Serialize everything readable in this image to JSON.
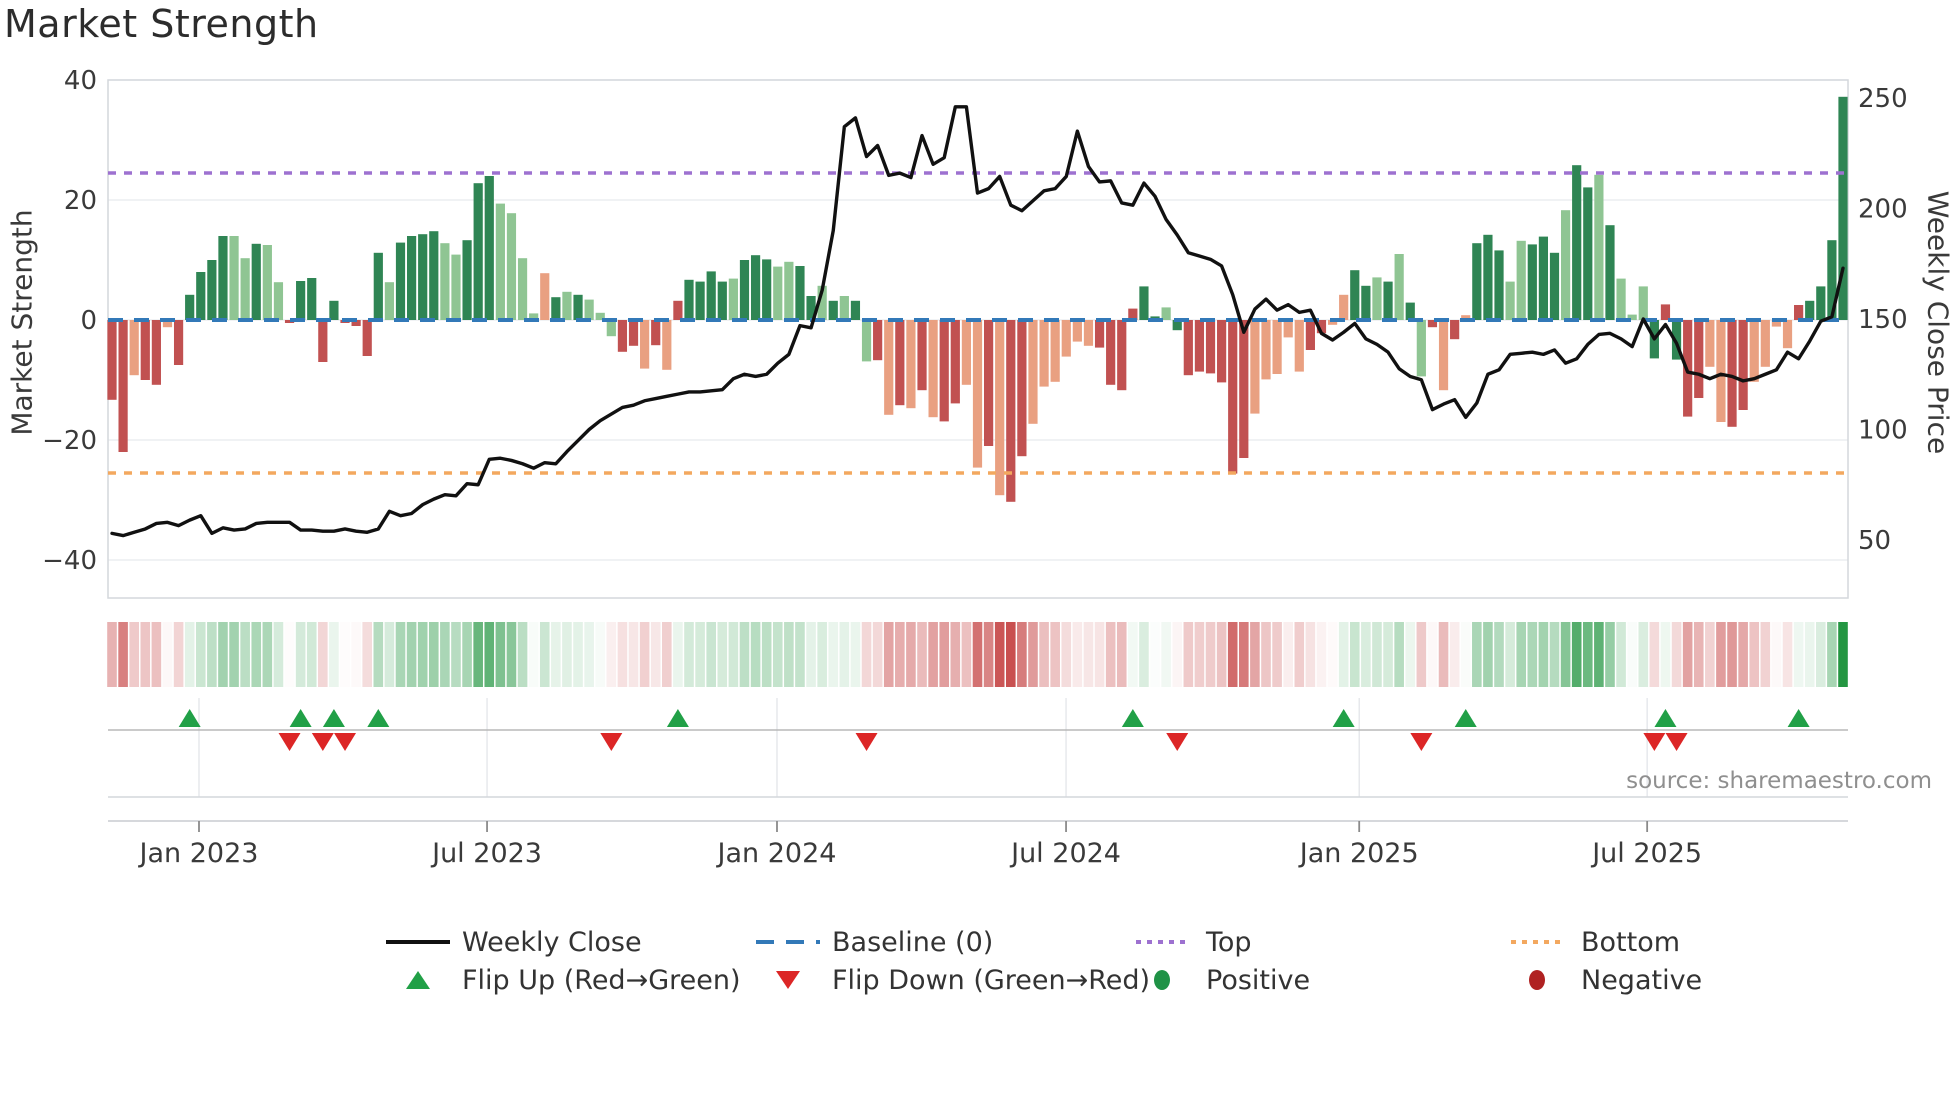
{
  "app": {
    "title": "Market Strength",
    "source_text": "source: sharemaestro.com"
  },
  "colors": {
    "bar_dark_green": "#2f8554",
    "bar_light_green": "#8fc593",
    "bar_red": "#c15151",
    "bar_salmon": "#e9a081",
    "baseline_blue": "#3279b8",
    "top_purple": "#9d71d0",
    "bottom_orange": "#f3a85f",
    "price_line": "#111111",
    "flip_up_green": "#21a047",
    "flip_down_red": "#dc2626",
    "positive_dot": "#1f9246",
    "negative_dot": "#b02222",
    "heat_green_base": [
      36,
      150,
      66
    ],
    "heat_red_base": [
      196,
      64,
      64
    ],
    "grid": "#e8eaee",
    "spine": "#d4d7dc",
    "tick_text": "#3a3a3a"
  },
  "legend": {
    "rows": [
      [
        {
          "label": "Weekly Close",
          "swatch": "line-black"
        },
        {
          "label": "Baseline (0)",
          "swatch": "dash-blue"
        },
        {
          "label": "Top",
          "swatch": "dot-purple"
        },
        {
          "label": "Bottom",
          "swatch": "dot-orange"
        }
      ],
      [
        {
          "label": "Flip Up (Red→Green)",
          "swatch": "tri-up"
        },
        {
          "label": "Flip Down (Green→Red)",
          "swatch": "tri-down"
        },
        {
          "label": "Positive",
          "swatch": "dot-green"
        },
        {
          "label": "Negative",
          "swatch": "dot-darkred"
        }
      ]
    ]
  },
  "chart_data": {
    "type": "bar",
    "subtype": "weekly strength bars + weekly close price line + heatmap strip + flip markers",
    "title": "Market Strength",
    "left_axis": {
      "label": "Market Strength",
      "ticks": [
        40,
        20,
        0,
        -20,
        -40
      ],
      "ylim": [
        -40,
        40
      ]
    },
    "right_axis": {
      "label": "Weekly Close Price",
      "ticks": [
        250,
        200,
        150,
        100,
        50
      ],
      "ylim": [
        40,
        260
      ]
    },
    "x_axis": {
      "ticks": [
        {
          "label": "Jan 2023",
          "week": 7.84
        },
        {
          "label": "Jul 2023",
          "week": 33.8
        },
        {
          "label": "Jan 2024",
          "week": 59.93
        },
        {
          "label": "Jul 2024",
          "week": 85.98
        },
        {
          "label": "Jan 2025",
          "week": 112.4
        },
        {
          "label": "Jul 2025",
          "week": 138.35
        }
      ]
    },
    "baseline": 0,
    "top_line": 24.5,
    "bottom_line": -25.5,
    "series": [
      {
        "name": "Strength",
        "type": "bar",
        "values": [
          -13.3,
          -22,
          -9.2,
          -10,
          -10.8,
          -1.2,
          -7.5,
          4.2,
          8,
          10,
          14,
          14,
          10.3,
          12.7,
          12.5,
          6.3,
          -0.5,
          6.5,
          7,
          -7,
          3.2,
          -0.5,
          -1,
          -6,
          11.2,
          6.3,
          12.9,
          14,
          14.3,
          14.8,
          12.8,
          10.9,
          13.3,
          22.8,
          24,
          19.4,
          17.8,
          10.3,
          1.1,
          7.8,
          3.8,
          4.7,
          4.2,
          3.4,
          1.2,
          -2.7,
          -5.3,
          -4.3,
          -8.1,
          -4.2,
          -8.3,
          3.2,
          6.7,
          6.4,
          8.1,
          6.4,
          6.9,
          10,
          10.8,
          10.1,
          8.9,
          9.7,
          9,
          4,
          5.7,
          3.2,
          4,
          3.2,
          -6.9,
          -6.7,
          -15.8,
          -14.2,
          -14.7,
          -11.7,
          -16.2,
          -16.9,
          -13.9,
          -10.8,
          -24.6,
          -21,
          -29.2,
          -30.3,
          -22.7,
          -17.3,
          -11.1,
          -10.3,
          -6.1,
          -3.6,
          -4.3,
          -4.6,
          -10.8,
          -11.7,
          1.9,
          5.6,
          0.6,
          2.1,
          -1.7,
          -9.2,
          -8.6,
          -8.9,
          -10.4,
          -25.6,
          -23,
          -15.6,
          -9.9,
          -9,
          -2.9,
          -8.6,
          -5,
          -2.2,
          -0.8,
          4.2,
          8.3,
          5.7,
          7.1,
          6.4,
          11,
          2.9,
          -9.4,
          -1.2,
          -11.7,
          -3.2,
          0.8,
          12.8,
          14.2,
          11.6,
          6.4,
          13.2,
          12.6,
          13.9,
          11.2,
          18.3,
          25.8,
          22.1,
          24.2,
          15.8,
          6.9,
          0.9,
          5.6,
          -6.4,
          2.6,
          -6.6,
          -16.1,
          -13,
          -7.8,
          -17,
          -17.8,
          -15,
          -10.3,
          -7.8,
          -1.1,
          -4.7,
          2.5,
          3.2,
          5.6,
          13.3,
          37.2
        ],
        "shades": "rrsrrsrddddlldllrddrdrrrdlddddlldddllllsdldlllrrsrsrddddldddllddldldlrsrsrsrrssrsrrssssssrrrrddldrrrrrrsssssrrssddldldlrsrsdddlldddlddldllldrdrrssrrssssrddddd"
      },
      {
        "name": "Weekly Close",
        "type": "line",
        "values": [
          53,
          52,
          53.5,
          55,
          57.5,
          58,
          56.5,
          59,
          61,
          53,
          55.5,
          54.5,
          55,
          57.5,
          58,
          58,
          58,
          54.5,
          54.5,
          54,
          54,
          55,
          54,
          53.5,
          55,
          63,
          61,
          62,
          66,
          68.5,
          70.5,
          70,
          75.5,
          75,
          86.5,
          87,
          86,
          84.5,
          82.5,
          85,
          84.5,
          90,
          95,
          100,
          104,
          107,
          110,
          111,
          113,
          114,
          115,
          116,
          117,
          117,
          117.5,
          118,
          123,
          125,
          124,
          125,
          130,
          134,
          147,
          146,
          163,
          190,
          237,
          241,
          223.5,
          228.5,
          215,
          216,
          214,
          233,
          220,
          223,
          246,
          246,
          207,
          209,
          214.5,
          201.5,
          199,
          203.5,
          208,
          209,
          214.5,
          235,
          219,
          212,
          212.5,
          202.5,
          201.5,
          211.5,
          205.5,
          195,
          188,
          180,
          178.5,
          177,
          174,
          161,
          144,
          154.5,
          159,
          154,
          156.5,
          153,
          154,
          143.5,
          140.5,
          144,
          148,
          141,
          138.5,
          135,
          127.5,
          124,
          122.5,
          109,
          111.5,
          113.5,
          105.5,
          112,
          125,
          127,
          134,
          134.5,
          135,
          134,
          136,
          130,
          132,
          138.5,
          143,
          143.5,
          141,
          137.5,
          150,
          141,
          147.5,
          139,
          126,
          125,
          123,
          125,
          124,
          122,
          123,
          125,
          127,
          135,
          132,
          140,
          149,
          151,
          173
        ]
      }
    ],
    "flip_up_weeks": [
      7,
      17,
      20,
      24,
      51,
      92,
      111,
      122,
      140,
      152
    ],
    "flip_down_weeks": [
      16,
      19,
      21,
      45,
      68,
      96,
      118,
      139,
      141
    ],
    "heatmap": "color strip mirrors bar values: red shades for negative weeks, green shades for positive weeks, intensity proportional to magnitude",
    "grid": "horizontal only",
    "legend_position": "bottom, two rows"
  }
}
